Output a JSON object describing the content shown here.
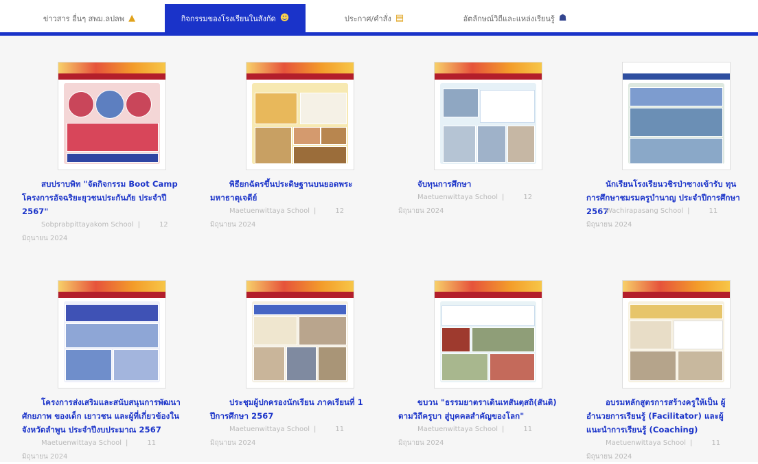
{
  "tabs": [
    {
      "label": "ข่าวสาร อื่นๆ สพม.ลปลพ",
      "icon": "school-icon",
      "active": false
    },
    {
      "label": "กิจกรรมของโรงเรียนในสังกัด",
      "icon": "students-icon",
      "active": true
    },
    {
      "label": "ประกาศ/คำสั่ง",
      "icon": "document-icon",
      "active": false
    },
    {
      "label": "อัตลักษณ์วิถีและแหล่งเรียนรู้",
      "icon": "learning-icon",
      "active": false
    }
  ],
  "posts": [
    {
      "title": "สบปราบพิท \"จัดกิจกรรม Boot Camp โครงการอัจฉริยะยุวชนประกันภัย ประจำปี 2567\"",
      "author": "Sobprabpittayakom School",
      "date": "12 มิถุนายน 2024"
    },
    {
      "title": "พิธียกฉัตรขึ้นประดิษฐานบนยอดพระมหาธาตุเจดีย์",
      "author": "Maetuenwittaya School",
      "date": "12 มิถุนายน 2024"
    },
    {
      "title": "จับทุนการศึกษา",
      "author": "Maetuenwittaya School",
      "date": "12 มิถุนายน 2024"
    },
    {
      "title": "นักเรียนโรงเรียนวชิรป่าซางเข้ารับ ทุนการศึกษาชมรมครูบำนาญ ประจำปีการศึกษา 2567",
      "author": "Wachirapasang School",
      "date": "11 มิถุนายน 2024"
    },
    {
      "title": "โครงการส่งเสริมและสนับสนุนการพัฒนาศักยภาพ ของเด็ก เยาวชน และผู้ที่เกี่ยวข้องในจังหวัดลำพูน ประจำปีงบประมาณ 2567",
      "author": "Maetuenwittaya School",
      "date": "11 มิถุนายน 2024"
    },
    {
      "title": "ประชุมผู้ปกครองนักเรียน ภาคเรียนที่ 1 ปีการศึกษา 2567",
      "author": "Maetuenwittaya School",
      "date": "11 มิถุนายน 2024"
    },
    {
      "title": "ขบวน \"ธรรมยาตราเดินเทสันตฺสถิ(สันติ) ตามวิถีครูบา สู่บุคคลสำคัญของโลก\"",
      "author": "Maetuenwittaya School",
      "date": "11 มิถุนายน 2024"
    },
    {
      "title": "อบรมหลักสูตรการสร้างครูให้เป็น ผู้อำนวยการเรียนรู้ (Facilitator) และผู้แนะนำการเรียนรู้ (Coaching)",
      "author": "Maetuenwittaya School",
      "date": "11 มิถุนายน 2024"
    }
  ],
  "colors": {
    "accent": "#1a33c9",
    "meta": "#b9b9b9",
    "background": "#f6f6f6"
  }
}
